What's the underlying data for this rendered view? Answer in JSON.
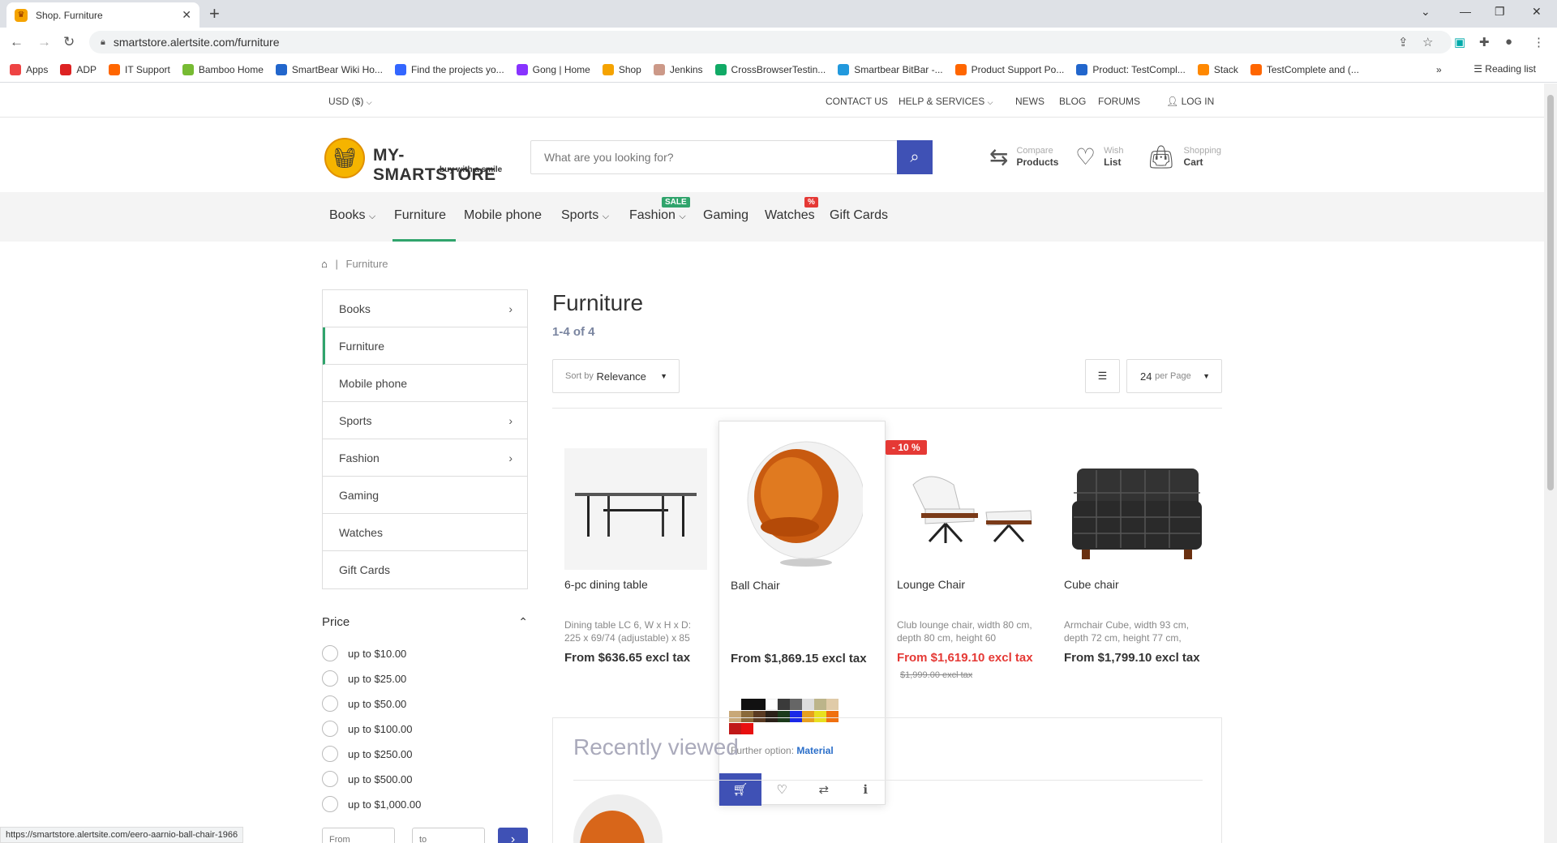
{
  "browser": {
    "tab_title": "Shop. Furniture",
    "url": "smartstore.alertsite.com/furniture",
    "bookmarks": [
      "Apps",
      "ADP",
      "IT Support",
      "Bamboo Home",
      "SmartBear Wiki Ho...",
      "Find the projects yo...",
      "Gong | Home",
      "Shop",
      "Jenkins",
      "CrossBrowserTestin...",
      "Smartbear BitBar -...",
      "Product Support Po...",
      "Product: TestCompl...",
      "Stack",
      "TestComplete and (..."
    ],
    "reading_list": "Reading list",
    "status_url": "https://smartstore.alertsite.com/eero-aarnio-ball-chair-1966"
  },
  "topbar": {
    "currency": "USD ($)",
    "contact": "CONTACT US",
    "help": "HELP & SERVICES",
    "news": "NEWS",
    "blog": "BLOG",
    "forums": "FORUMS",
    "login": "LOG IN"
  },
  "header": {
    "logo_name": "MY-SMARTSTORE",
    "logo_tagline": "buy with a smile",
    "search_placeholder": "What are you looking for?",
    "compare": {
      "top": "Compare",
      "bottom": "Products"
    },
    "wish": {
      "top": "Wish",
      "bottom": "List"
    },
    "cart": {
      "top": "Shopping",
      "bottom": "Cart"
    }
  },
  "nav": {
    "items": [
      "Books",
      "Furniture",
      "Mobile phone",
      "Sports",
      "Fashion",
      "Gaming",
      "Watches",
      "Gift Cards"
    ],
    "sale_badge": "SALE",
    "percent_badge": "%"
  },
  "breadcrumb": {
    "current": "Furniture"
  },
  "sidebar": {
    "categories": [
      "Books",
      "Furniture",
      "Mobile phone",
      "Sports",
      "Fashion",
      "Gaming",
      "Watches",
      "Gift Cards"
    ],
    "price_title": "Price",
    "price_options": [
      "up to $10.00",
      "up to $25.00",
      "up to $50.00",
      "up to $100.00",
      "up to $250.00",
      "up to $500.00",
      "up to $1,000.00"
    ],
    "from_placeholder": "From",
    "to_placeholder": "to"
  },
  "main": {
    "title": "Furniture",
    "count": "1-4 of 4",
    "sort_prefix": "Sort by",
    "sort_value": "Relevance",
    "per_page_value": "24",
    "per_page_suffix": "per Page",
    "products": [
      {
        "name": "6-pc dining table",
        "desc": "Dining table LC 6, W x H x D: 225 x 69/74 (adjustable) x 85",
        "price": "From $636.65 excl tax"
      },
      {
        "name": "Ball Chair",
        "desc": "",
        "price": "From $1,869.15 excl tax"
      },
      {
        "name": "Lounge Chair",
        "desc": "Club lounge chair, width 80 cm, depth 80 cm, height 60",
        "price": "From $1,619.10 excl tax",
        "old_price": "$1,999.00 excl tax",
        "discount": "- 10 %"
      },
      {
        "name": "Cube chair",
        "desc": "Armchair Cube, width 93 cm, depth 72 cm, height 77 cm,",
        "price": "From $1,799.10 excl tax"
      }
    ],
    "further_label": "Further option:",
    "further_value": "Material",
    "recently_viewed": "Recently viewed"
  },
  "swatch_colors": [
    "#111111",
    "#111111",
    "#ffffff",
    "#3a3a3a",
    "#666666",
    "#dddddd",
    "#bcb48a",
    "#e0cba8",
    "#c8a878",
    "#8a6a3a",
    "#5a3a22",
    "#2a2018",
    "#1b3a1b",
    "#1a28e8",
    "#e8a020",
    "#e8e020",
    "#f07010",
    "#c01818",
    "#e81010"
  ],
  "colors": {
    "accent": "#3f51b5",
    "green": "#30a46c",
    "sale": "#e53935"
  }
}
